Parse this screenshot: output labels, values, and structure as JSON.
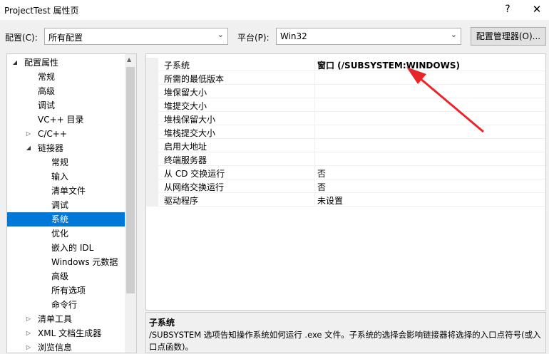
{
  "window": {
    "title": "ProjectTest 属性页",
    "help": "?",
    "close": "✕"
  },
  "toolbar": {
    "config_label": "配置(C):",
    "config_value": "所有配置",
    "platform_label": "平台(P):",
    "platform_value": "Win32",
    "config_manager_button": "配置管理器(O)..."
  },
  "tree": {
    "items": [
      {
        "label": "配置属性",
        "exp": "◢"
      },
      {
        "label": "常规"
      },
      {
        "label": "高级"
      },
      {
        "label": "调试"
      },
      {
        "label": "VC++ 目录"
      },
      {
        "label": "C/C++",
        "exp": "▷"
      },
      {
        "label": "链接器",
        "exp": "◢"
      },
      {
        "label": "常规"
      },
      {
        "label": "输入"
      },
      {
        "label": "清单文件"
      },
      {
        "label": "调试"
      },
      {
        "label": "系统"
      },
      {
        "label": "优化"
      },
      {
        "label": "嵌入的 IDL"
      },
      {
        "label": "Windows 元数据"
      },
      {
        "label": "高级"
      },
      {
        "label": "所有选项"
      },
      {
        "label": "命令行"
      },
      {
        "label": "清单工具",
        "exp": "▷"
      },
      {
        "label": "XML 文档生成器",
        "exp": "▷"
      },
      {
        "label": "浏览信息",
        "exp": "▷"
      }
    ]
  },
  "properties": [
    {
      "name": "子系统",
      "value": "窗口 (/SUBSYSTEM:WINDOWS)"
    },
    {
      "name": "所需的最低版本",
      "value": ""
    },
    {
      "name": "堆保留大小",
      "value": ""
    },
    {
      "name": "堆提交大小",
      "value": ""
    },
    {
      "name": "堆栈保留大小",
      "value": ""
    },
    {
      "name": "堆栈提交大小",
      "value": ""
    },
    {
      "name": "启用大地址",
      "value": ""
    },
    {
      "name": "终端服务器",
      "value": ""
    },
    {
      "name": "从 CD 交换运行",
      "value": "否"
    },
    {
      "name": "从网络交换运行",
      "value": "否"
    },
    {
      "name": "驱动程序",
      "value": "未设置"
    }
  ],
  "description": {
    "title": "子系统",
    "text": "/SUBSYSTEM 选项告知操作系统如何运行 .exe 文件。子系统的选择会影响链接器将选择的入口点符号(或入口点函数)。"
  },
  "colors": {
    "selection": "#0078d7",
    "annotation_arrow": "#e8262a"
  }
}
